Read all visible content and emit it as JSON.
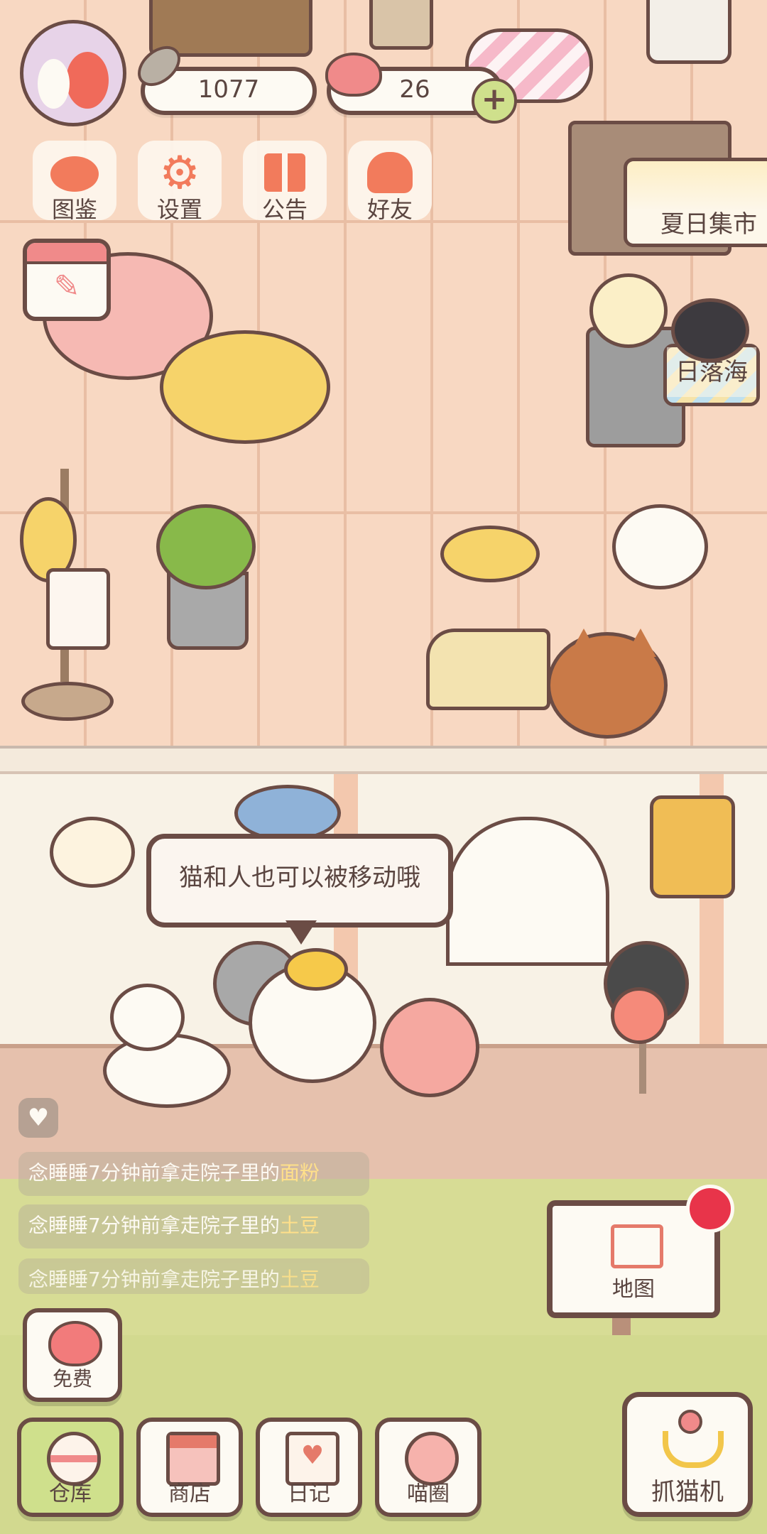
{
  "currency": {
    "fish_amount": "1077",
    "heart_amount": "26"
  },
  "top_menu": [
    {
      "label": "图鉴",
      "icon": "cat-face-icon"
    },
    {
      "label": "设置",
      "icon": "gear-icon"
    },
    {
      "label": "公告",
      "icon": "gift-icon"
    },
    {
      "label": "好友",
      "icon": "friends-icon"
    }
  ],
  "signs": {
    "summer_market": "夏日集市",
    "sunset_sea": "日落海"
  },
  "speech_bubble": "猫和人也可以被移动哦",
  "activity_feed": [
    {
      "prefix": "念睡睡",
      "middle": "7分钟前拿走院子里的",
      "item": "面粉"
    },
    {
      "prefix": "念睡睡",
      "middle": "7分钟前拿走院子里的",
      "item": "土豆"
    },
    {
      "prefix": "念睡睡",
      "middle": "7分钟前拿走院子里的",
      "item": "土豆"
    }
  ],
  "free_button": "免费",
  "map_button": "地图",
  "bottom_tabs": [
    {
      "label": "仓库",
      "icon": "warehouse-icon",
      "active": true
    },
    {
      "label": "商店",
      "icon": "shop-icon",
      "active": false
    },
    {
      "label": "日记",
      "icon": "diary-icon",
      "active": false
    },
    {
      "label": "喵圈",
      "icon": "cat-planet-icon",
      "active": false
    }
  ],
  "claw_machine_button": "抓猫机",
  "colors": {
    "outline": "#6b4c45",
    "text": "#5a4540",
    "notification": "#e8344a",
    "active_tab": "#cfe08c"
  }
}
